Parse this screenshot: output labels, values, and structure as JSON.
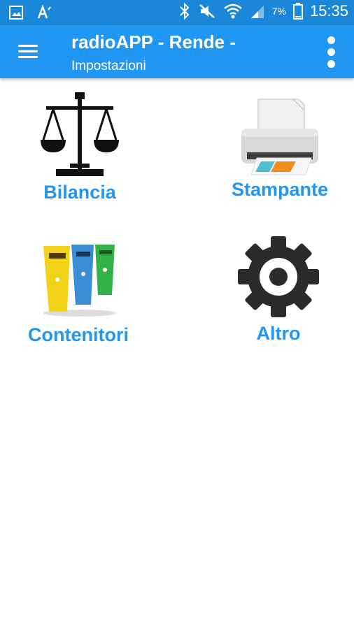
{
  "status_bar": {
    "time": "15:35",
    "battery": "7%"
  },
  "app_bar": {
    "title": "radioAPP - Rende -",
    "subtitle": "Impostazioni"
  },
  "tiles": [
    {
      "label": "Bilancia",
      "icon": "scale-icon"
    },
    {
      "label": "Stampante",
      "icon": "printer-icon"
    },
    {
      "label": "Contenitori",
      "icon": "bins-icon"
    },
    {
      "label": "Altro",
      "icon": "gear-icon"
    }
  ],
  "colors": {
    "status_bar": "#1a87d8",
    "app_bar": "#2196f3",
    "label": "#2196f3"
  }
}
